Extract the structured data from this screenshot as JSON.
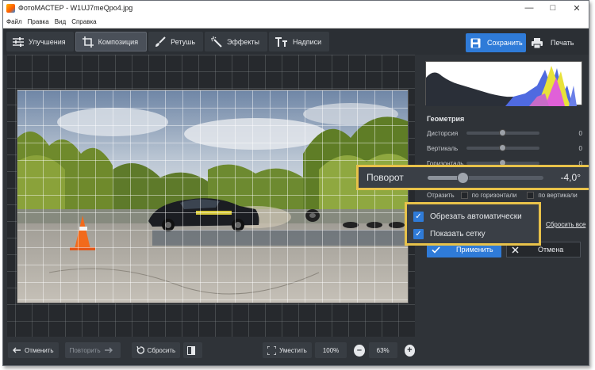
{
  "window": {
    "title": "ФотоМАСТЕР - W1UJ7meQpo4.jpg"
  },
  "menu": [
    "Файл",
    "Правка",
    "Вид",
    "Справка"
  ],
  "tabs": [
    {
      "label": "Улучшения",
      "icon": "sliders-icon",
      "active": false
    },
    {
      "label": "Композиция",
      "icon": "crop-icon",
      "active": true
    },
    {
      "label": "Ретушь",
      "icon": "brush-icon",
      "active": false
    },
    {
      "label": "Эффекты",
      "icon": "magic-wand-icon",
      "active": false
    },
    {
      "label": "Надписи",
      "icon": "text-icon",
      "active": false
    }
  ],
  "actions": {
    "save": "Сохранить",
    "print": "Печать"
  },
  "panel": {
    "section_title": "Геометрия",
    "sliders": [
      {
        "label": "Дисторсия",
        "value": "0",
        "level": 0.5
      },
      {
        "label": "Вертикаль",
        "value": "0",
        "level": 0.5
      },
      {
        "label": "Горизонталь",
        "value": "0",
        "level": 0.5
      }
    ],
    "reflect": {
      "label": "Отразить",
      "horizontal": "по горизонтали",
      "vertical": "по вертикали"
    },
    "reset_all": "Сбросить все",
    "apply": "Применить",
    "cancel": "Отмена"
  },
  "rotation": {
    "label": "Поворот",
    "value": "-4,0°",
    "level": 0.3
  },
  "options": {
    "auto_crop": "Обрезать автоматически",
    "show_grid": "Показать сетку"
  },
  "bottom": {
    "undo": "Отменить",
    "redo": "Повторить",
    "reset": "Сбросить",
    "fit": "Уместить",
    "zoom_100": "100%",
    "zoom_value": "63%"
  },
  "colors": {
    "accent": "#2f7bd8",
    "highlight": "#e8c24a",
    "background": "#2f3338"
  }
}
